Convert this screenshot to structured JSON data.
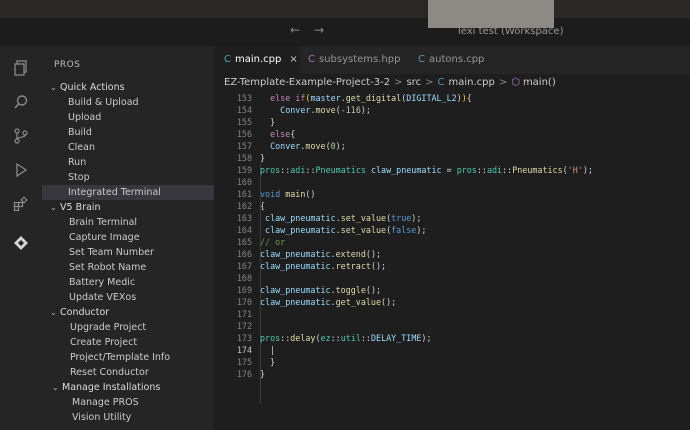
{
  "titlebar": {
    "nav_back": "←",
    "nav_forward": "→",
    "search_text": "lexi test (Workspace)"
  },
  "activity_bar": [
    "explorer-icon",
    "search-icon",
    "source-control-icon",
    "run-debug-icon",
    "extensions-icon",
    "pros-icon"
  ],
  "sidebar": {
    "title": "PROS",
    "groups": [
      {
        "label": "Quick Actions",
        "items": [
          "Build & Upload",
          "Upload",
          "Build",
          "Clean",
          "Run",
          "Stop",
          "Integrated Terminal"
        ]
      },
      {
        "label": "V5 Brain",
        "items": [
          "Brain Terminal",
          "Capture Image",
          "Set Team Number",
          "Set Robot Name",
          "Battery Medic",
          "Update VEXos"
        ]
      },
      {
        "label": "Conductor",
        "items": [
          "Upgrade Project",
          "Create Project",
          "Project/Template Info",
          "Reset Conductor"
        ]
      },
      {
        "label": "Manage Installations",
        "items": [
          "Manage PROS",
          "Vision Utility"
        ]
      }
    ],
    "selected": "Integrated Terminal"
  },
  "tabs": [
    {
      "label": "main.cpp",
      "icon": "C",
      "close": "×",
      "active": true
    },
    {
      "label": "subsystems.hpp",
      "icon": "C",
      "active": false
    },
    {
      "label": "autons.cpp",
      "icon": "C",
      "active": false
    }
  ],
  "breadcrumb": [
    "EZ-Template-Example-Project-3-2",
    "src",
    "main.cpp",
    "main()"
  ],
  "breadcrumb_sep": ">",
  "code": {
    "numbers": [
      "153",
      "154",
      "155",
      "156",
      "157",
      "158",
      "159",
      "160",
      "161",
      "162",
      "163",
      "164",
      "165",
      "166",
      "167",
      "168",
      "169",
      "170",
      "171",
      "172",
      "173",
      "174",
      "175",
      "176"
    ],
    "current_line": "174",
    "lines": [
      "  else if(master.get_digital(DIGITAL_L2)){",
      "    Conver.move(-116);",
      "  }",
      "  else{",
      "  Conver.move(0);",
      "}",
      "pros::adi::Pneumatics claw_pneumatic = pros::adi::Pneumatics('H');",
      "",
      "void main()",
      "{",
      " claw_pneumatic.set_value(true);",
      " claw_pneumatic.set_value(false);",
      "// or",
      "claw_pneumatic.extend();",
      "claw_pneumatic.retract();",
      "",
      "claw_pneumatic.toggle();",
      "claw_pneumatic.get_value();",
      "",
      "",
      "pros::delay(ez::util::DELAY_TIME);",
      "  |",
      "  }",
      "}"
    ]
  }
}
